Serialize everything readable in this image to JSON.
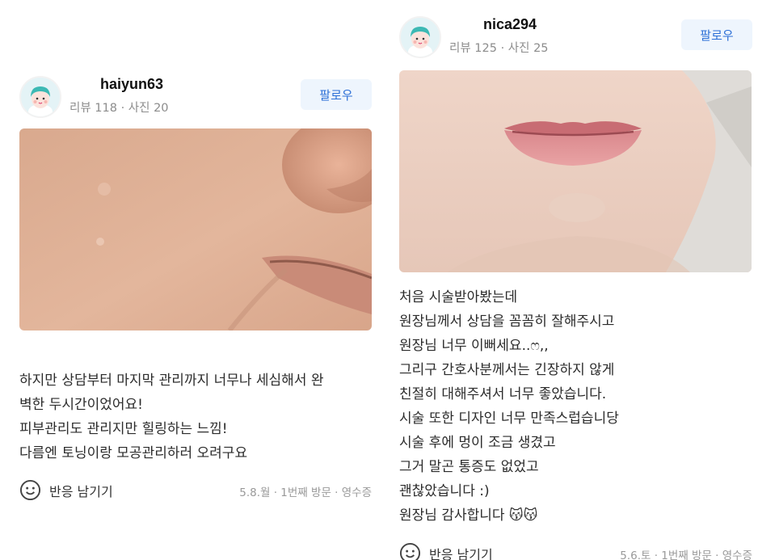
{
  "reviews": [
    {
      "username": "haiyun63",
      "stats": "리뷰 118 · 사진 20",
      "follow_label": "팔로우",
      "body_lines": [
        "하지만 상담부터 마지막 관리까지 너무나 세심해서 완",
        "벽한 두시간이었어요!",
        "피부관리도 관리지만 힐링하는 느낌!",
        "다름엔 토닝이랑 모공관리하러 오려구요"
      ],
      "react_label": "반응 남기기",
      "meta": "5.8.월 · 1번째 방문 · 영수증"
    },
    {
      "username": "nica294",
      "stats": "리뷰 125 · 사진 25",
      "follow_label": "팔로우",
      "body_lines": [
        "처음 시술받아봤는데",
        "원장님께서 상담을 꼼꼼히 잘해주시고",
        "원장님 너무 이뻐세요..ෆ,,",
        "그리구 간호사분께서는 긴장하지 않게",
        "친절히 대해주셔서 너무 좋았습니다.",
        "시술 또한 디자인 너무 만족스럽습니당",
        "시술 후에 멍이 조금 생겼고",
        "그거 말곤 통증도 없었고",
        "괜찮았습니다 :)",
        "원장님 감사합니다 😽😽"
      ],
      "react_label": "반응 남기기",
      "meta": "5.6.토 · 1번째 방문 · 영수증"
    }
  ],
  "icons": {
    "avatar": "user-avatar-icon",
    "react": "smile-icon"
  },
  "colors": {
    "accent": "#2c6fd6",
    "follow_bg": "#eef5fd",
    "muted": "#8c8c8c"
  }
}
